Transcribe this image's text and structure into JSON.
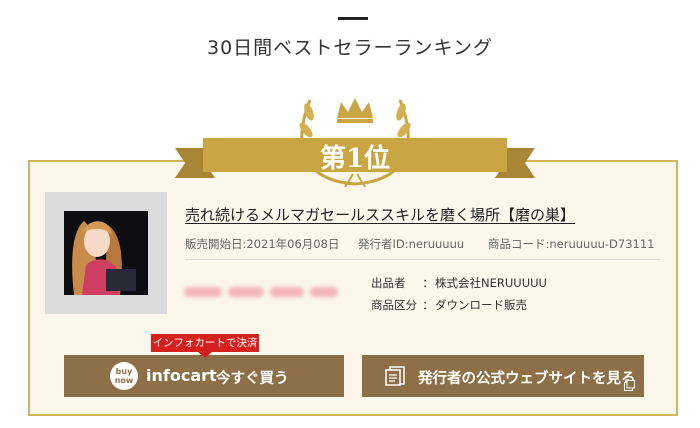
{
  "section": {
    "title": "30日間ベストセラーランキング"
  },
  "rank": {
    "label": "第1位"
  },
  "product": {
    "title": "売れ続けるメルマガセールススキルを磨く場所【磨の巣】",
    "sales_start": "販売開始日:2021年06月08日",
    "publisher_id": "発行者ID:neruuuuu",
    "product_code": "商品コード:neruuuuu-D73111",
    "seller_label": "出品者",
    "seller_sep": "：",
    "seller_value": "株式会社NERUUUUU",
    "category_label": "商品区分",
    "category_sep": "：",
    "category_value": "ダウンロード販売"
  },
  "buttons": {
    "pay_badge": "インフォカートで決済",
    "buy_circle_top": "buy",
    "buy_circle_bottom": "now",
    "infocart": "infocart",
    "buy_label": "今すぐ買う",
    "site_label": "発行者の公式ウェブサイトを見る"
  },
  "colors": {
    "gold": "#cfb55d",
    "card_bg": "#fbf7eb",
    "button": "#8d6f48",
    "badge_red": "#d5201e"
  }
}
